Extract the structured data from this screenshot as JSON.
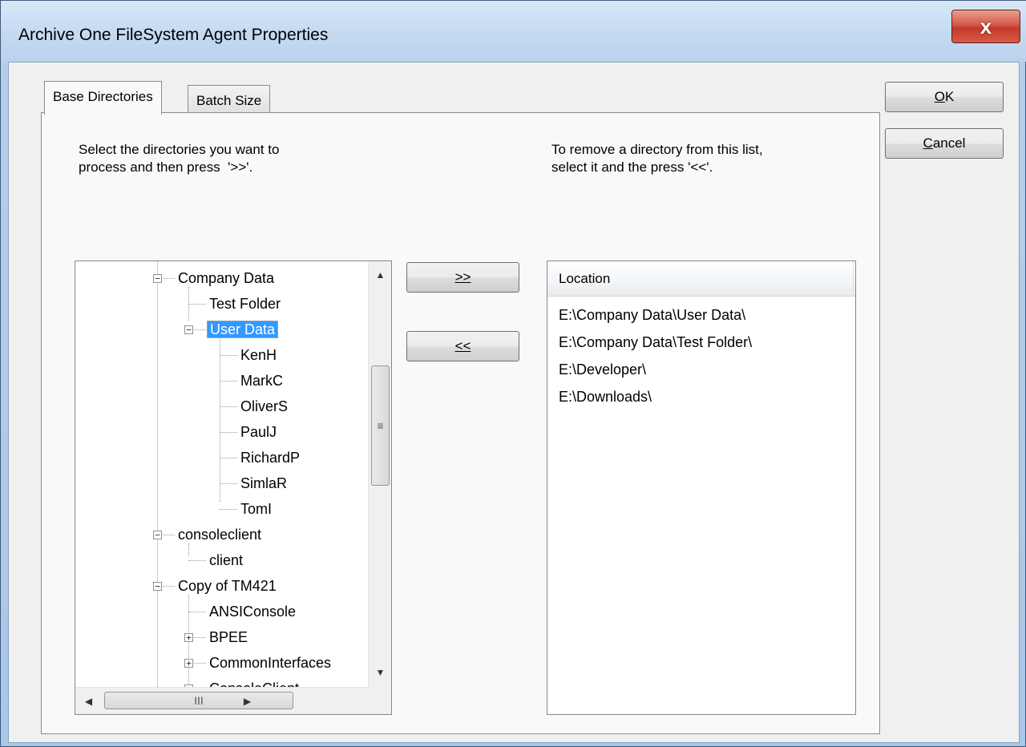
{
  "window": {
    "title": "Archive One FileSystem Agent Properties",
    "close_label": "x"
  },
  "tabs": [
    {
      "label": "Base Directories",
      "active": true
    },
    {
      "label": "Batch Size",
      "active": false
    }
  ],
  "left_instruction": "Select the directories you want to\nprocess and then press  '>>'.",
  "right_instruction": "To remove a directory from this list,\nselect it and the press '<<'.",
  "tree": {
    "items": [
      {
        "label": "Company Data",
        "expander": "−"
      },
      {
        "label": "Test Folder",
        "expander": ""
      },
      {
        "label": "User Data",
        "expander": "−",
        "selected": true
      },
      {
        "label": "KenH",
        "expander": ""
      },
      {
        "label": "MarkC",
        "expander": ""
      },
      {
        "label": "OliverS",
        "expander": ""
      },
      {
        "label": "PaulJ",
        "expander": ""
      },
      {
        "label": "RichardP",
        "expander": ""
      },
      {
        "label": "SimlaR",
        "expander": ""
      },
      {
        "label": "TomI",
        "expander": ""
      },
      {
        "label": "consoleclient",
        "expander": "−"
      },
      {
        "label": "client",
        "expander": ""
      },
      {
        "label": "Copy of TM421",
        "expander": "−"
      },
      {
        "label": "ANSIConsole",
        "expander": ""
      },
      {
        "label": "BPEE",
        "expander": "+"
      },
      {
        "label": "CommonInterfaces",
        "expander": "+"
      },
      {
        "label": "ConsoleClient",
        "expander": "+"
      }
    ],
    "vscroll_thumb_glyph": "≡",
    "hscroll_thumb_glyph": "III",
    "arrow_up": "▲",
    "arrow_down": "▼",
    "arrow_left": "◀",
    "arrow_right": "▶"
  },
  "buttons": {
    "add": ">>",
    "remove": "<<",
    "ok": "OK",
    "cancel": "Cancel"
  },
  "list": {
    "column_header": "Location",
    "rows": [
      "E:\\Company Data\\User Data\\",
      "E:\\Company Data\\Test Folder\\",
      "E:\\Developer\\",
      "E:\\Downloads\\"
    ]
  }
}
